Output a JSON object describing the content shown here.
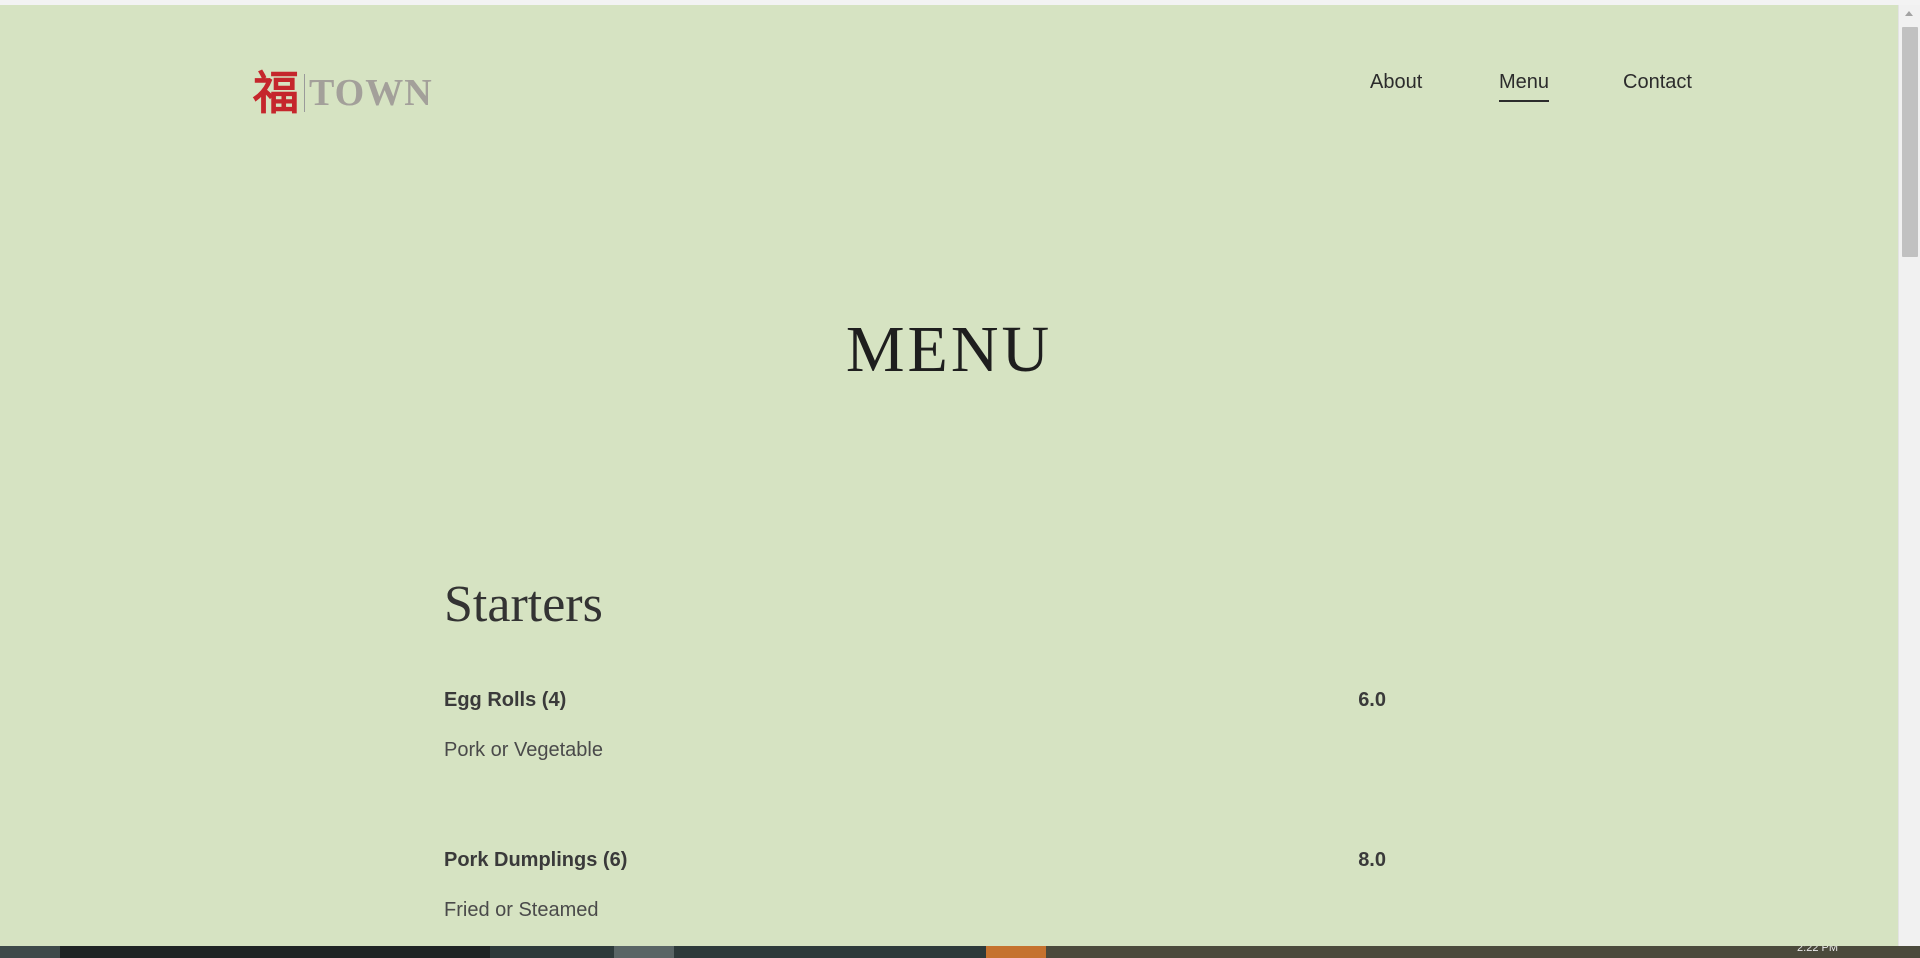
{
  "header": {
    "logo_char": "福",
    "logo_word": "TOWN",
    "nav": [
      {
        "label": "About"
      },
      {
        "label": "Menu"
      },
      {
        "label": "Contact"
      }
    ]
  },
  "page_title": "MENU",
  "sections": [
    {
      "title": "Starters",
      "items": [
        {
          "name": "Egg Rolls (4)",
          "price": "6.0",
          "description": "Pork or Vegetable"
        },
        {
          "name": "Pork Dumplings (6)",
          "price": "8.0",
          "description": "Fried or Steamed"
        }
      ]
    }
  ],
  "taskbar": {
    "clock": "2:22 PM"
  },
  "colors": {
    "background": "#d6e3c2",
    "logo_char": "#c5262c",
    "logo_word": "#a3a09a",
    "text": "#2c2c2c"
  }
}
